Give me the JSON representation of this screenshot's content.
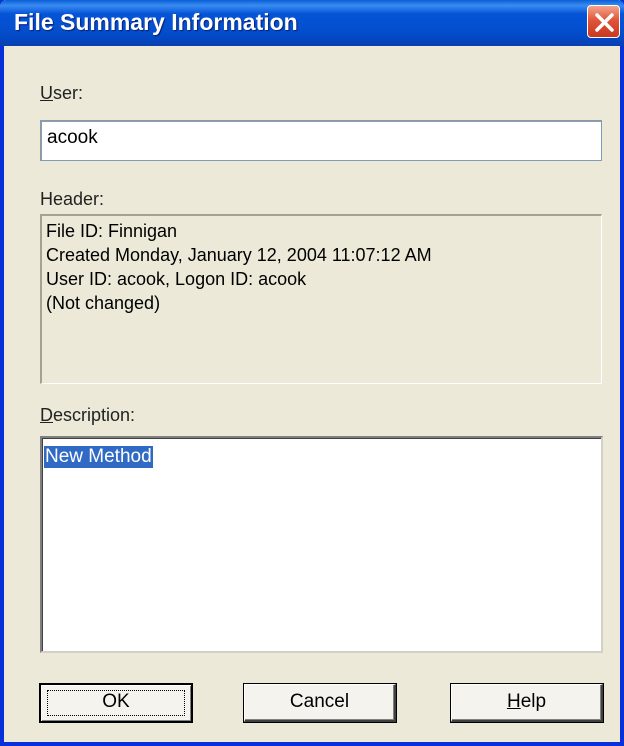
{
  "window": {
    "title": "File Summary Information",
    "close_icon": "close-icon"
  },
  "user": {
    "label_prefix": "U",
    "label_rest": "ser:",
    "value": "acook"
  },
  "header": {
    "label": "Header:",
    "lines": [
      "File ID: Finnigan",
      "Created Monday, January 12, 2004  11:07:12 AM",
      "User ID: acook,  Logon ID: acook",
      "(Not changed)"
    ]
  },
  "description": {
    "label_prefix": "D",
    "label_rest": "escription:",
    "value": "New Method"
  },
  "buttons": {
    "ok": "OK",
    "cancel": "Cancel",
    "help_prefix": "H",
    "help_rest": "elp"
  },
  "colors": {
    "titlebar": "#0554d7",
    "dialog_bg": "#ece9d8",
    "selection": "#316ac5"
  }
}
